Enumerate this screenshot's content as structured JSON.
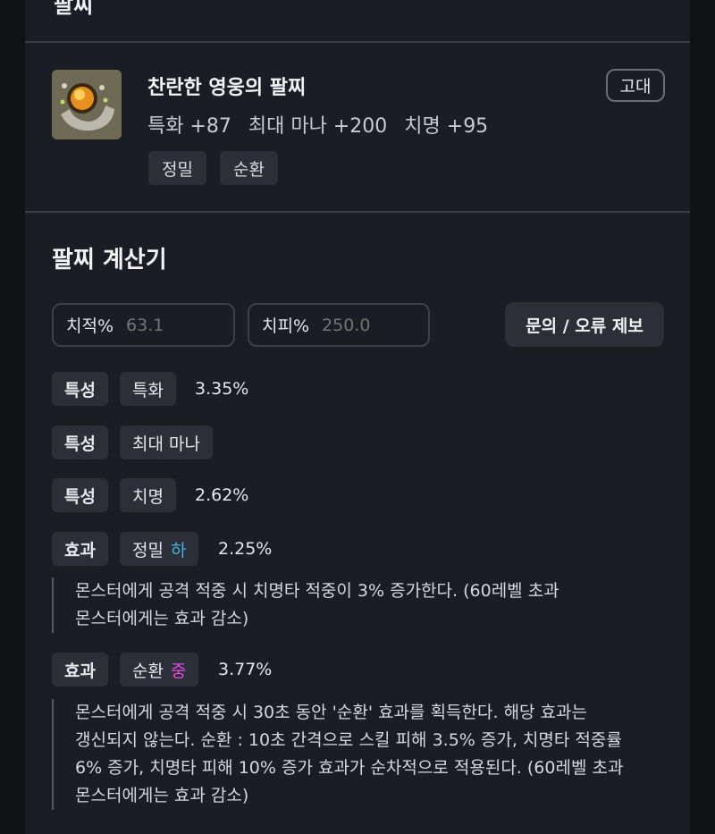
{
  "section_title": "팔찌",
  "item": {
    "icon": "bracelet-item-icon",
    "name": "찬란한 영웅의 팔찌",
    "grade": "고대",
    "stats": [
      "특화 +87",
      "최대 마나 +200",
      "치명 +95"
    ],
    "tags": [
      "정밀",
      "순환"
    ]
  },
  "calculator": {
    "title": "팔찌 계산기",
    "crit_rate": {
      "label": "치적%",
      "placeholder": "63.1"
    },
    "crit_dmg": {
      "label": "치피%",
      "placeholder": "250.0"
    },
    "report_button": "문의 / 오류 제보",
    "rows": [
      {
        "type": "특성",
        "name": "특화",
        "value": "3.35%"
      },
      {
        "type": "특성",
        "name": "최대 마나",
        "value": ""
      },
      {
        "type": "특성",
        "name": "치명",
        "value": "2.62%"
      },
      {
        "type": "효과",
        "name": "정밀",
        "level": "하",
        "value": "2.25%",
        "desc_lines": [
          "몬스터에게 공격 적중 시 치명타 적중이 3% 증가한다. (60레벨 초과",
          "몬스터에게는 효과 감소)"
        ]
      },
      {
        "type": "효과",
        "name": "순환",
        "level": "중",
        "value": "3.77%",
        "desc_lines": [
          "몬스터에게 공격 적중 시 30초 동안 '순환' 효과를 획득한다. 해당 효과는",
          "갱신되지 않는다. 순환 : 10초 간격으로 스킬 피해 3.5% 증가, 치명타 적중률",
          "6% 증가, 치명타 피해 10% 증가 효과가 순차적으로 적용된다. (60레벨 초과",
          "몬스터에게는 효과 감소)"
        ]
      }
    ]
  },
  "colors": {
    "level_low": "#3fb5ea",
    "level_mid": "#e54ce4",
    "panel_bg": "#1b1d24",
    "chip_bg": "#2c2f37"
  }
}
